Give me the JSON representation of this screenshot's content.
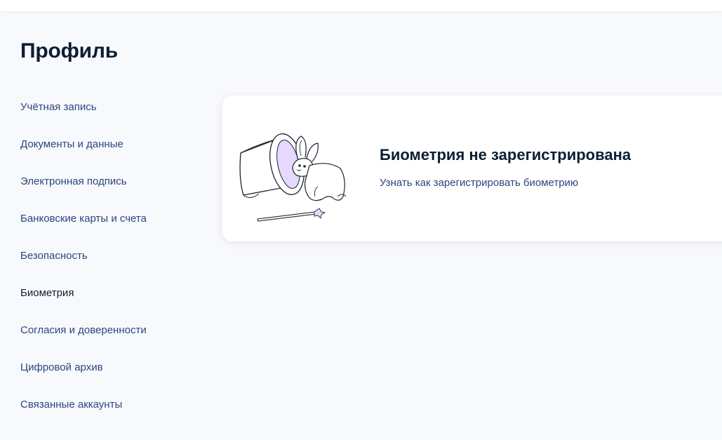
{
  "page": {
    "title": "Профиль"
  },
  "sidebar": {
    "items": [
      {
        "label": "Учётная запись"
      },
      {
        "label": "Документы и данные"
      },
      {
        "label": "Электронная подпись"
      },
      {
        "label": "Банковские карты и счета"
      },
      {
        "label": "Безопасность"
      },
      {
        "label": "Биометрия",
        "active": true
      },
      {
        "label": "Согласия и доверенности"
      },
      {
        "label": "Цифровой архив"
      },
      {
        "label": "Связанные аккаунты"
      }
    ]
  },
  "biometry_card": {
    "title": "Биометрия не зарегистрирована",
    "link_label": "Узнать как зарегистрировать биометрию",
    "illustration": "magic-hat-rabbit-illustration"
  },
  "colors": {
    "background": "#f8f9fc",
    "title_text": "#0b1f33",
    "link_text": "#2a4680",
    "card_background": "#ffffff",
    "illustration_accent": "#e6d9ff"
  }
}
